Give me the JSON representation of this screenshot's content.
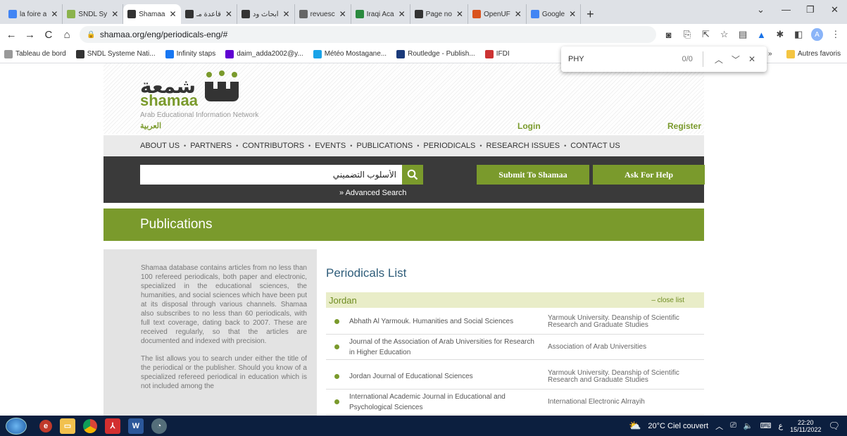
{
  "browser": {
    "tabs": [
      {
        "label": "la foire a",
        "icon": "google-icon",
        "color": "#4285f4",
        "active": false
      },
      {
        "label": "SNDL Sy",
        "icon": "sndl-icon",
        "color": "#8bb34c",
        "active": false
      },
      {
        "label": "Shamaa",
        "icon": "shamaa-icon",
        "color": "#333333",
        "active": true
      },
      {
        "label": "قاعدة مـ",
        "icon": "shamaa-icon",
        "color": "#333333",
        "active": false
      },
      {
        "label": "أبحاث ود",
        "icon": "shamaa-icon",
        "color": "#333333",
        "active": false
      },
      {
        "label": "revuesc",
        "icon": "globe-icon",
        "color": "#666666",
        "active": false
      },
      {
        "label": "Iraqi Aca",
        "icon": "iraqi-icon",
        "color": "#2a8a3e",
        "active": false
      },
      {
        "label": "Page no",
        "icon": "shamaa-icon",
        "color": "#333333",
        "active": false
      },
      {
        "label": "OpenUF",
        "icon": "openuf-icon",
        "color": "#d9531e",
        "active": false
      },
      {
        "label": "Google",
        "icon": "translate-icon",
        "color": "#4285f4",
        "active": false
      }
    ],
    "new_tab": "+",
    "url": "shamaa.org/eng/periodicals-eng/#",
    "bookmarks": [
      {
        "label": "Tableau de bord",
        "color": "#999999"
      },
      {
        "label": "SNDL Systeme Nati...",
        "color": "#333333"
      },
      {
        "label": "Infinity staps",
        "color": "#1877f2"
      },
      {
        "label": "daim_adda2002@y...",
        "color": "#6001d2"
      },
      {
        "label": "Météo Mostagane...",
        "color": "#1aa3e8"
      },
      {
        "label": "Routledge - Publish...",
        "color": "#1a3a7a"
      },
      {
        "label": "IFDI",
        "color": "#cc3333"
      }
    ],
    "bookmarks_more": "»",
    "other_bookmarks": "Autres favoris",
    "profile_initial": "A"
  },
  "findbar": {
    "query": "PHY",
    "count": "0/0"
  },
  "site": {
    "logo_arabic": "شمعة",
    "logo_english": "shamaa",
    "tagline": "Arab Educational Information Network",
    "lang_link": "العربية",
    "login": "Login",
    "register": "Register",
    "nav": [
      "ABOUT US",
      "PARTNERS",
      "CONTRIBUTORS",
      "EVENTS",
      "PUBLICATIONS",
      "PERIODICALS",
      "RESEARCH ISSUES",
      "CONTACT US"
    ],
    "search_value": "الأسلوب التضميني",
    "advanced_search": "» Advanced Search",
    "submit_label": "Submit To Shamaa",
    "help_label": "Ask For Help",
    "page_title": "Publications",
    "brand_color": "#7a9a2c"
  },
  "sidebar": {
    "paragraphs": [
      "Shamaa database contains articles from no less than 100 refereed periodicals, both paper and electronic, specialized in the educational sciences, the humanities, and social sciences which have been put at its disposal through various channels. Shamaa also subscribes to no less than 60 periodicals, with full text coverage, dating back to 2007. These are received regularly, so that the articles are documented and indexed with precision.",
      "The list allows you to search under either the title of the periodical or the publisher. Should you know of a specialized refereed periodical in education which is not included among the"
    ]
  },
  "periodicals": {
    "title": "Periodicals List",
    "country": "Jordan",
    "close_list": "– close list",
    "rows": [
      {
        "title": "Abhath Al Yarmouk. Humanities and Social Sciences",
        "publisher": "Yarmouk University. Deanship of Scientific Research and Graduate Studies"
      },
      {
        "title": "Journal of the Association of Arab Universities for Research in Higher Education",
        "publisher": "Association of Arab Universities"
      },
      {
        "title": "Jordan Journal of Educational Sciences",
        "publisher": "Yarmouk University. Deanship of Scientific Research and Graduate Studies"
      },
      {
        "title": "International Academic Journal in Educational and Psychological Sciences",
        "publisher": "International Electronic Alrrayih"
      }
    ]
  },
  "taskbar": {
    "weather": "20°C  Ciel couvert",
    "time": "22:20",
    "date": "15/11/2022",
    "lang": "ع"
  }
}
